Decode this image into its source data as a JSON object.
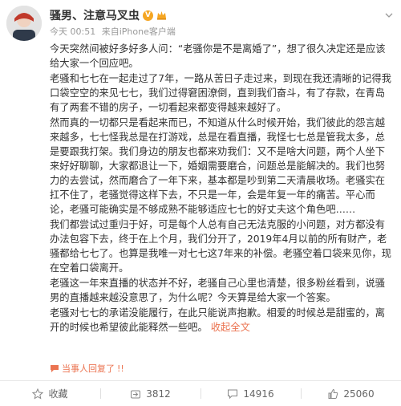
{
  "post": {
    "username": "骚男、注意马叉虫",
    "v_badge": "V",
    "time": "今天 00:51",
    "source_prefix": "来自",
    "source": "iPhone客户端",
    "paragraphs": [
      "今天突然间被好多好多人问：“老骚你是不是离婚了”，想了很久决定还是应该给大家一个回应吧。",
      "老骚和七七在一起走过了7年，一路从苦日子走过来，到现在我还清晰的记得我口袋空空的来见七七，我们过得窘困潦倒，直到我们奋斗，有了存款，在青岛有了两套不错的房子，一切看起来都变得越来越好了。",
      "然而真的一切都只是看起来而已，不知道从什么时候开始，我们彼此的怨言越来越多，七七怪我总是在打游戏，总是在看直播，我怪七七总是管我太多，总是要跟我打架。我们身边的朋友也都来劝我们：又不是啥大问题，两个人坐下来好好聊聊，大家都退让一下，婚姻需要磨合，问题总是能解决的。我们也努力的去尝试，然而磨合了一年下来，基本都是吵到第二天清晨收场。老骚实在扛不住了，老骚觉得这样下去，不只是一年，会是年复一年的痛苦。平心而论，老骚可能确实是不够成熟不能够适应七七的好丈夫这个角色吧……",
      "我们都尝试过重归于好，可是每个人总有自己无法克服的小问题，对方都没有办法包容下去，终于在上个月，我们分开了，2019年4月以前的所有财产，老骚都给七七了。也算是我唯一对七七这7年来的补偿。老骚空着口袋来见你，现在空着口袋离开。",
      "老骚这一年来直播的状态并不好，老骚自己心里也清楚，很多粉丝看到，说骚男的直播越来越没意思了，为什么呢？今天算是给大家一个答案。"
    ],
    "last_paragraph": "老骚对七七的承诺没能履行，在此只能说声抱歉。相爱的时候总是甜蜜的，离开的时候也希望彼此能释然一些吧。",
    "collapse_label": "收起全文",
    "reply_label": "当事人回复了",
    "reply_count": "!!",
    "actions": {
      "favorite_label": "收藏",
      "repost_count": "3812",
      "comment_count": "14916",
      "like_count": "25060"
    }
  },
  "colors": {
    "link": "#eb7350",
    "badge": "#f5a623",
    "text": "#333333",
    "meta": "#999999"
  }
}
